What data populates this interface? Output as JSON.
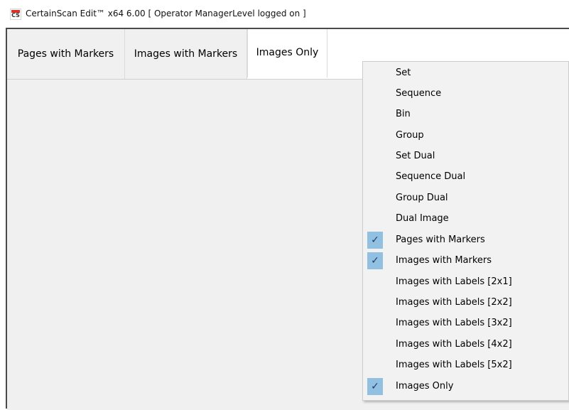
{
  "window": {
    "title": "CertainScan Edit™ x64 6.00   [ Operator ManagerLevel logged on ]",
    "icon": "cs-app-icon",
    "icon_text": "CS"
  },
  "tabs": [
    {
      "label": "Pages with Markers",
      "active": false
    },
    {
      "label": "Images with Markers",
      "active": false
    },
    {
      "label": "Images Only",
      "active": true
    }
  ],
  "context_menu": {
    "items": [
      {
        "label": "Set",
        "checked": false
      },
      {
        "label": "Sequence",
        "checked": false
      },
      {
        "label": "Bin",
        "checked": false
      },
      {
        "label": "Group",
        "checked": false
      },
      {
        "label": "Set Dual",
        "checked": false
      },
      {
        "label": "Sequence Dual",
        "checked": false
      },
      {
        "label": "Group Dual",
        "checked": false
      },
      {
        "label": "Dual Image",
        "checked": false
      },
      {
        "label": "Pages with Markers",
        "checked": true
      },
      {
        "label": "Images with Markers",
        "checked": true
      },
      {
        "label": "Images with Labels [2x1]",
        "checked": false
      },
      {
        "label": "Images with Labels [2x2]",
        "checked": false
      },
      {
        "label": "Images with Labels [3x2]",
        "checked": false
      },
      {
        "label": "Images with Labels [4x2]",
        "checked": false
      },
      {
        "label": "Images with Labels [5x2]",
        "checked": false
      },
      {
        "label": "Images Only",
        "checked": true
      }
    ],
    "check_glyph": "✓",
    "check_color": "#92c0e0"
  }
}
